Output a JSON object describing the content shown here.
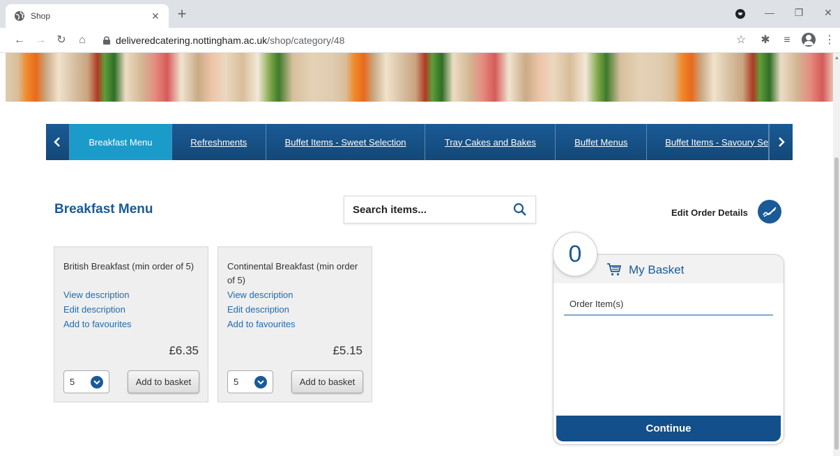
{
  "browser": {
    "tab_title": "Shop",
    "url_host": "deliveredcatering.nottingham.ac.uk",
    "url_path": "/shop/category/48"
  },
  "categories": [
    {
      "label": "Breakfast Menu",
      "active": true
    },
    {
      "label": "Refreshments",
      "active": false
    },
    {
      "label": "Buffet Items - Sweet Selection",
      "active": false
    },
    {
      "label": "Tray Cakes and Bakes",
      "active": false
    },
    {
      "label": "Buffet Menus",
      "active": false
    },
    {
      "label": "Buffet Items - Savoury Se",
      "active": false
    }
  ],
  "main": {
    "page_title": "Breakfast Menu",
    "search_placeholder": "Search items...",
    "edit_order_label": "Edit Order Details"
  },
  "products": [
    {
      "name": "British Breakfast (min order of 5)",
      "view_label": "View description",
      "edit_label": "Edit description",
      "fav_label": "Add to favourites",
      "price": "£6.35",
      "qty": "5",
      "add_label": "Add to basket"
    },
    {
      "name": "Continental Breakfast (min order of 5)",
      "view_label": "View description",
      "edit_label": "Edit description",
      "fav_label": "Add to favourites",
      "price": "£5.15",
      "qty": "5",
      "add_label": "Add to basket"
    }
  ],
  "basket": {
    "count": "0",
    "title": "My Basket",
    "order_label": "Order Item(s)",
    "continue_label": "Continue"
  },
  "colors": {
    "primary": "#1a5a96",
    "active_tab": "#1a9bc9",
    "link": "#1f6bb0"
  }
}
